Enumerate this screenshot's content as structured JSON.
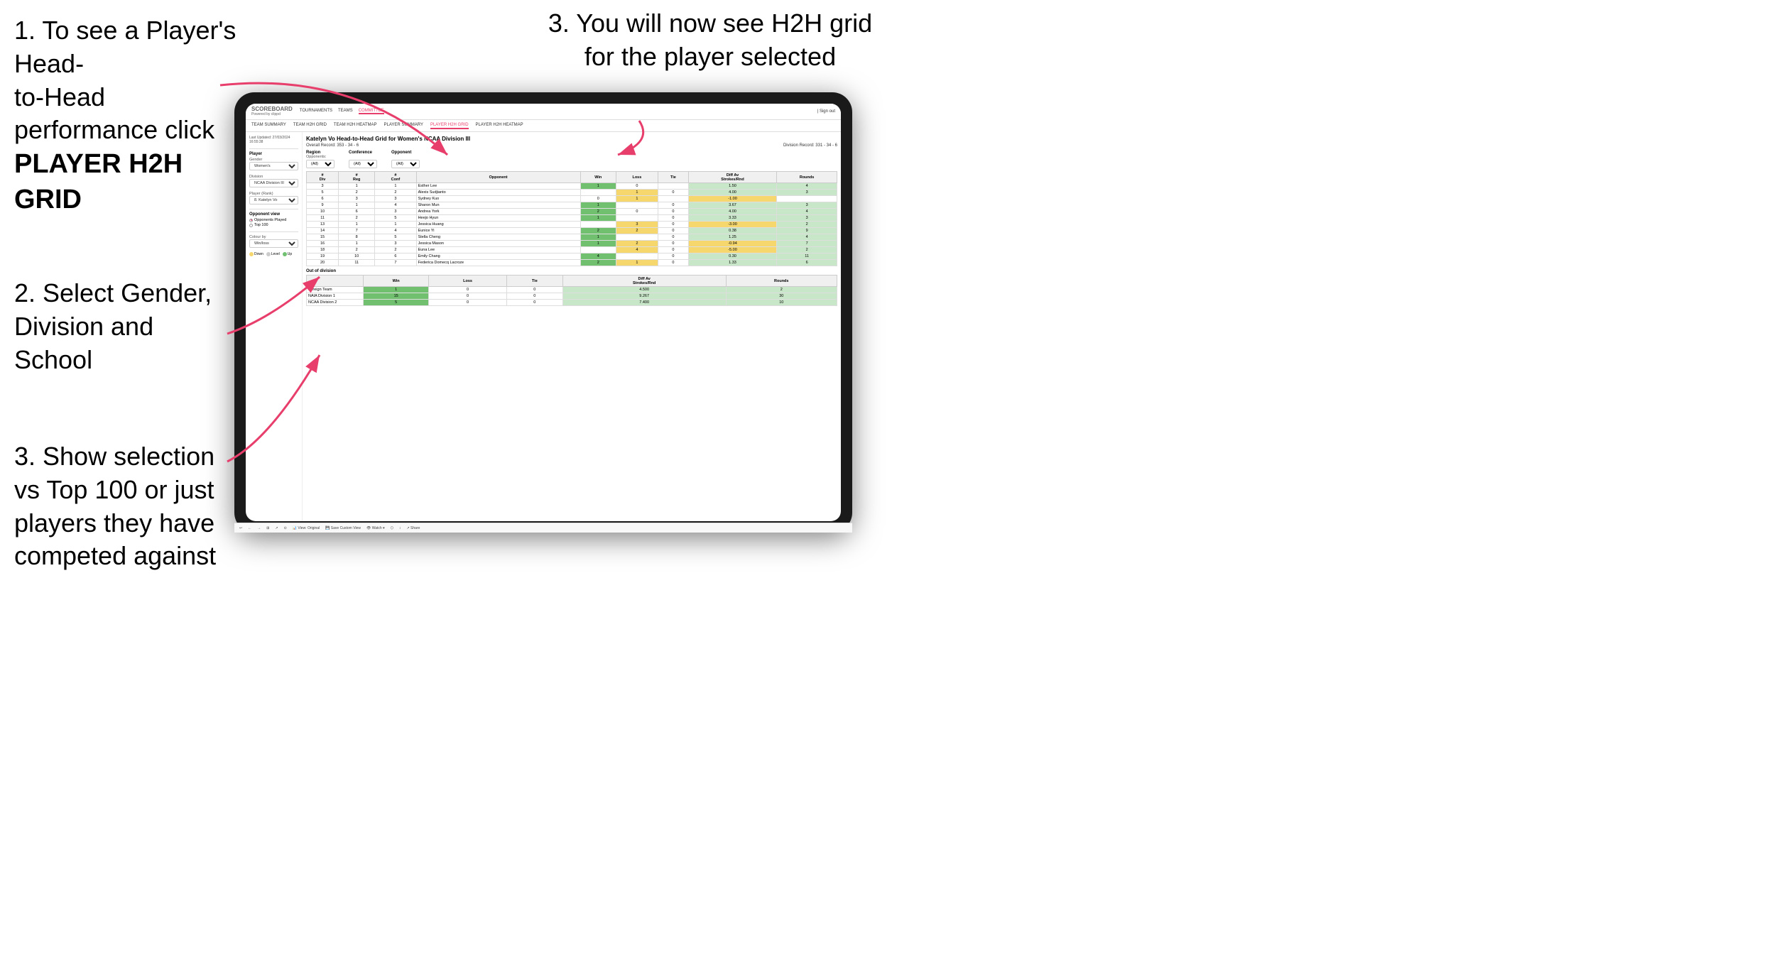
{
  "instructions": {
    "top_left_line1": "1. To see a Player's Head-",
    "top_left_line2": "to-Head performance click",
    "top_left_bold": "PLAYER H2H GRID",
    "top_right": "3. You will now see H2H grid\nfor the player selected",
    "mid_left_line1": "2. Select Gender,",
    "mid_left_line2": "Division and",
    "mid_left_line3": "School",
    "bottom_left_line1": "3. Show selection",
    "bottom_left_line2": "vs Top 100 or just",
    "bottom_left_line3": "players they have",
    "bottom_left_line4": "competed against"
  },
  "nav": {
    "logo": "SCOREBOARD",
    "logo_sub": "Powered by clippd",
    "links": [
      "TOURNAMENTS",
      "TEAMS",
      "COMMITTEE"
    ],
    "active_link": "COMMITTEE",
    "sign_in": "Sign out"
  },
  "sub_nav": {
    "links": [
      "TEAM SUMMARY",
      "TEAM H2H GRID",
      "TEAM H2H HEATMAP",
      "PLAYER SUMMARY",
      "PLAYER H2H GRID",
      "PLAYER H2H HEATMAP"
    ],
    "active": "PLAYER H2H GRID"
  },
  "sidebar": {
    "timestamp": "Last Updated: 27/03/2024\n16:55:38",
    "player_label": "Player",
    "gender_label": "Gender",
    "gender_value": "Women's",
    "division_label": "Division",
    "division_value": "NCAA Division III",
    "player_rank_label": "Player (Rank)",
    "player_rank_value": "8. Katelyn Vo",
    "opponent_view_label": "Opponent view",
    "radio1": "Opponents Played",
    "radio2": "Top 100",
    "colour_by_label": "Colour by",
    "colour_by_value": "Win/loss",
    "legend": [
      {
        "color": "#f5d76e",
        "label": "Down"
      },
      {
        "color": "#cccccc",
        "label": "Level"
      },
      {
        "color": "#70c070",
        "label": "Up"
      }
    ]
  },
  "page": {
    "title": "Katelyn Vo Head-to-Head Grid for Women's NCAA Division III",
    "overall_record": "Overall Record: 353 - 34 - 6",
    "division_record": "Division Record: 331 - 34 - 6",
    "filters": {
      "region_label": "Region",
      "opponents_label": "Opponents:",
      "region_value": "(All)",
      "conference_label": "Conference",
      "conference_value": "(All)",
      "opponent_label": "Opponent",
      "opponent_value": "(All)"
    },
    "table_headers": [
      "#\nDiv",
      "#\nReg",
      "#\nConf",
      "Opponent",
      "Win",
      "Loss",
      "Tie",
      "Diff Av\nStrokes/Rnd",
      "Rounds"
    ],
    "table_rows": [
      {
        "div": "3",
        "reg": "1",
        "conf": "1",
        "opponent": "Esther Lee",
        "win": "1",
        "loss": "0",
        "tie": "",
        "diff": "1.50",
        "rounds": "4"
      },
      {
        "div": "5",
        "reg": "2",
        "conf": "2",
        "opponent": "Alexis Sudjianto",
        "win": "",
        "loss": "1",
        "tie": "0",
        "diff": "4.00",
        "rounds": "3"
      },
      {
        "div": "6",
        "reg": "3",
        "conf": "3",
        "opponent": "Sydney Kuo",
        "win": "0",
        "loss": "1",
        "tie": "",
        "diff": "-1.00",
        "rounds": ""
      },
      {
        "div": "9",
        "reg": "1",
        "conf": "4",
        "opponent": "Sharon Mun",
        "win": "1",
        "loss": "",
        "tie": "0",
        "diff": "3.67",
        "rounds": "3"
      },
      {
        "div": "10",
        "reg": "6",
        "conf": "3",
        "opponent": "Andrea York",
        "win": "2",
        "loss": "0",
        "tie": "0",
        "diff": "4.00",
        "rounds": "4"
      },
      {
        "div": "11",
        "reg": "2",
        "conf": "5",
        "opponent": "Heejo Hyun",
        "win": "1",
        "loss": "",
        "tie": "0",
        "diff": "3.33",
        "rounds": "3"
      },
      {
        "div": "13",
        "reg": "1",
        "conf": "1",
        "opponent": "Jessica Huang",
        "win": "",
        "loss": "3",
        "tie": "0",
        "diff": "-3.00",
        "rounds": "2"
      },
      {
        "div": "14",
        "reg": "7",
        "conf": "4",
        "opponent": "Eunice Yi",
        "win": "2",
        "loss": "2",
        "tie": "0",
        "diff": "0.38",
        "rounds": "9"
      },
      {
        "div": "15",
        "reg": "8",
        "conf": "5",
        "opponent": "Stella Cheng",
        "win": "1",
        "loss": "",
        "tie": "0",
        "diff": "1.25",
        "rounds": "4"
      },
      {
        "div": "16",
        "reg": "1",
        "conf": "3",
        "opponent": "Jessica Mason",
        "win": "1",
        "loss": "2",
        "tie": "0",
        "diff": "-0.94",
        "rounds": "7"
      },
      {
        "div": "18",
        "reg": "2",
        "conf": "2",
        "opponent": "Euna Lee",
        "win": "",
        "loss": "4",
        "tie": "0",
        "diff": "-5.00",
        "rounds": "2"
      },
      {
        "div": "19",
        "reg": "10",
        "conf": "6",
        "opponent": "Emily Chang",
        "win": "4",
        "loss": "",
        "tie": "0",
        "diff": "0.30",
        "rounds": "11"
      },
      {
        "div": "20",
        "reg": "11",
        "conf": "7",
        "opponent": "Federica Domecq Lacroze",
        "win": "2",
        "loss": "1",
        "tie": "0",
        "diff": "1.33",
        "rounds": "6"
      }
    ],
    "out_of_division_label": "Out of division",
    "out_of_division_rows": [
      {
        "name": "Foreign Team",
        "win": "1",
        "loss": "0",
        "tie": "0",
        "diff": "4.500",
        "rounds": "2"
      },
      {
        "name": "NAIA Division 1",
        "win": "15",
        "loss": "0",
        "tie": "0",
        "diff": "9.267",
        "rounds": "30"
      },
      {
        "name": "NCAA Division 2",
        "win": "5",
        "loss": "0",
        "tie": "0",
        "diff": "7.400",
        "rounds": "10"
      }
    ]
  },
  "toolbar": {
    "items": [
      "↩",
      "←",
      "→",
      "⊞",
      "↗",
      "⊙",
      "View: Original",
      "Save Custom View",
      "👁 Watch ▾",
      "⬡",
      "↕",
      "Share"
    ]
  }
}
